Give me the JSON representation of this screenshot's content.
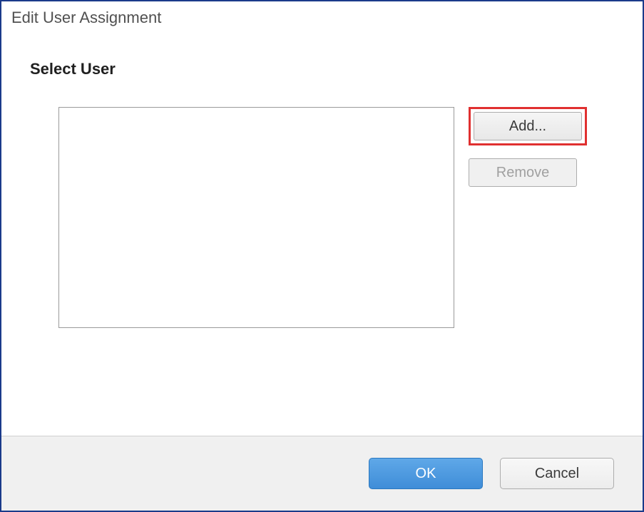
{
  "dialog": {
    "title": "Edit User Assignment"
  },
  "section": {
    "header": "Select User"
  },
  "buttons": {
    "add": "Add...",
    "remove": "Remove",
    "ok": "OK",
    "cancel": "Cancel"
  },
  "state": {
    "remove_disabled": true,
    "add_highlighted": true
  }
}
